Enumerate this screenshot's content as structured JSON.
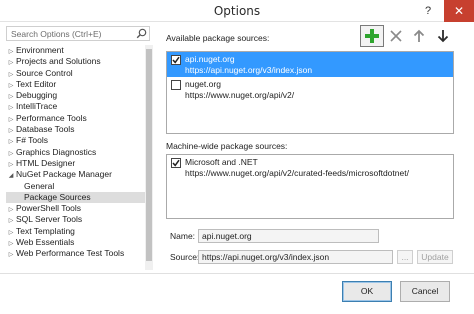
{
  "window": {
    "title": "Options",
    "help_glyph": "?",
    "close_glyph": "✕"
  },
  "search": {
    "placeholder": "Search Options (Ctrl+E)"
  },
  "tree": {
    "items": [
      {
        "label": "Environment",
        "arrow": "▷"
      },
      {
        "label": "Projects and Solutions",
        "arrow": "▷"
      },
      {
        "label": "Source Control",
        "arrow": "▷"
      },
      {
        "label": "Text Editor",
        "arrow": "▷"
      },
      {
        "label": "Debugging",
        "arrow": "▷"
      },
      {
        "label": "IntelliTrace",
        "arrow": "▷"
      },
      {
        "label": "Performance Tools",
        "arrow": "▷"
      },
      {
        "label": "Database Tools",
        "arrow": "▷"
      },
      {
        "label": "F# Tools",
        "arrow": "▷"
      },
      {
        "label": "Graphics Diagnostics",
        "arrow": "▷"
      },
      {
        "label": "HTML Designer",
        "arrow": "▷"
      },
      {
        "label": "NuGet Package Manager",
        "arrow": "◢"
      },
      {
        "label": "General",
        "child": true
      },
      {
        "label": "Package Sources",
        "child": true,
        "selected": true
      },
      {
        "label": "PowerShell Tools",
        "arrow": "▷"
      },
      {
        "label": "SQL Server Tools",
        "arrow": "▷"
      },
      {
        "label": "Text Templating",
        "arrow": "▷"
      },
      {
        "label": "Web Essentials",
        "arrow": "▷"
      },
      {
        "label": "Web Performance Test Tools",
        "arrow": "▷"
      }
    ]
  },
  "available": {
    "heading": "Available package sources:",
    "sources": [
      {
        "name": "api.nuget.org",
        "url": "https://api.nuget.org/v3/index.json",
        "checked": true,
        "selected": true
      },
      {
        "name": "nuget.org",
        "url": "https://www.nuget.org/api/v2/",
        "checked": false,
        "selected": false
      }
    ]
  },
  "machine": {
    "heading": "Machine-wide package sources:",
    "sources": [
      {
        "name": "Microsoft and .NET",
        "url": "https://www.nuget.org/api/v2/curated-feeds/microsoftdotnet/",
        "checked": true
      }
    ]
  },
  "toolbar": {
    "add_icon": "plus-icon",
    "remove_icon": "x-icon",
    "up_icon": "arrow-up-icon",
    "down_icon": "arrow-down-icon"
  },
  "fields": {
    "name_label": "Name:",
    "name_value": "api.nuget.org",
    "source_label": "Source:",
    "source_value": "https://api.nuget.org/v3/index.json",
    "browse_label": "...",
    "update_label": "Update"
  },
  "buttons": {
    "ok": "OK",
    "cancel": "Cancel"
  },
  "colors": {
    "selection": "#3399ff",
    "add_green": "#2fa52f",
    "close_red": "#c7402f"
  }
}
